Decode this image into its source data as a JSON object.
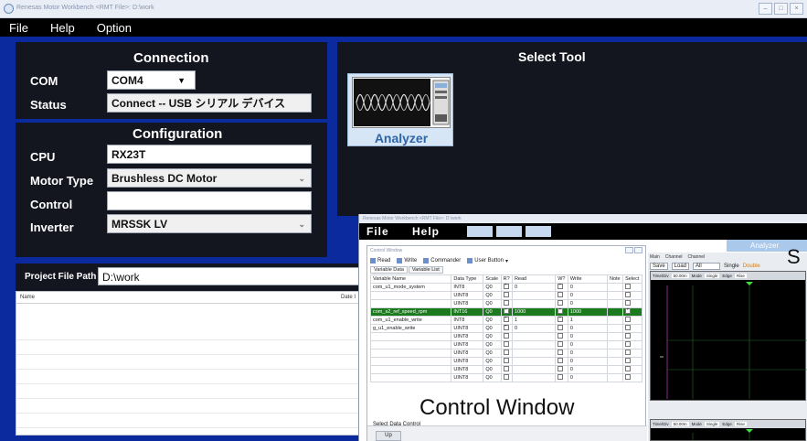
{
  "window": {
    "title": "Renesas Motor Workbench   <RMT File>: D:\\work"
  },
  "menu": {
    "file": "File",
    "help": "Help",
    "option": "Option"
  },
  "connection": {
    "title": "Connection",
    "com_label": "COM",
    "com_value": "COM4",
    "status_label": "Status",
    "status_value": "Connect -- USB シリアル デバイス"
  },
  "configuration": {
    "title": "Configuration",
    "cpu_label": "CPU",
    "cpu_value": "RX23T",
    "motor_label": "Motor Type",
    "motor_value": "Brushless DC Motor",
    "control_label": "Control",
    "control_value": "",
    "inverter_label": "Inverter",
    "inverter_value": "MRSSK LV"
  },
  "select_tool": {
    "title": "Select Tool",
    "analyzer_label": "Analyzer"
  },
  "project": {
    "path_label": "Project File Path",
    "path_value": "D:\\work",
    "col_name": "Name",
    "col_date": "Date I"
  },
  "overlay": {
    "title": "Renesas Motor Workbench   <RMT File>: D:\\work",
    "menu_file": "File",
    "menu_help": "Help",
    "analyzer_button": "Analyzer",
    "big_s": "S",
    "big_label": "Control Window",
    "control_window": {
      "title": "Control Window",
      "toolbar": {
        "read": "Read",
        "write": "Write",
        "commander": "Commander",
        "user_button": "User Button"
      },
      "tabs": [
        "Variable Data",
        "Variable List"
      ],
      "columns": [
        "Variable Name",
        "Data Type",
        "Scale",
        "R?",
        "Read",
        "W?",
        "Write",
        "Note",
        "Select"
      ],
      "rows": [
        {
          "name": "com_u1_mode_system",
          "type": "INT8",
          "scale": "Q0",
          "r": true,
          "read": "0",
          "w": true,
          "write": "0",
          "sel": false
        },
        {
          "name": "",
          "type": "UINT8",
          "scale": "Q0",
          "r": false,
          "read": "",
          "w": false,
          "write": "0",
          "sel": false
        },
        {
          "name": "",
          "type": "UINT8",
          "scale": "Q0",
          "r": false,
          "read": "",
          "w": false,
          "write": "0",
          "sel": false
        },
        {
          "name": "com_s2_ref_speed_rpm",
          "type": "INT16",
          "scale": "Q0",
          "r": true,
          "read": "1000",
          "w": true,
          "write": "1000",
          "sel": true
        },
        {
          "name": "com_u1_enable_write",
          "type": "INT8",
          "scale": "Q0",
          "r": true,
          "read": "1",
          "w": true,
          "write": "1",
          "sel": false
        },
        {
          "name": "g_u1_enable_write",
          "type": "UINT8",
          "scale": "Q0",
          "r": true,
          "read": "0",
          "w": false,
          "write": "0",
          "sel": false
        },
        {
          "name": "",
          "type": "UINT8",
          "scale": "Q0",
          "r": false,
          "read": "",
          "w": false,
          "write": "0",
          "sel": false
        },
        {
          "name": "",
          "type": "UINT8",
          "scale": "Q0",
          "r": false,
          "read": "",
          "w": false,
          "write": "0",
          "sel": false
        },
        {
          "name": "",
          "type": "UINT8",
          "scale": "Q0",
          "r": false,
          "read": "",
          "w": false,
          "write": "0",
          "sel": false
        },
        {
          "name": "",
          "type": "UINT8",
          "scale": "Q0",
          "r": false,
          "read": "",
          "w": false,
          "write": "0",
          "sel": false
        },
        {
          "name": "",
          "type": "UINT8",
          "scale": "Q0",
          "r": false,
          "read": "",
          "w": false,
          "write": "0",
          "sel": false
        },
        {
          "name": "",
          "type": "UINT8",
          "scale": "Q0",
          "r": false,
          "read": "",
          "w": false,
          "write": "0",
          "sel": false
        }
      ],
      "footer_label": "Select Data Control",
      "up_button": "Up"
    },
    "analyzer_pane": {
      "tabs": [
        "Main",
        "Channel",
        "Channel"
      ],
      "save": "Save",
      "load": "Load",
      "all": "All",
      "single": "Single",
      "double": "Double",
      "time_div_label": "Time/Div",
      "time_div_value": "50.00m",
      "mode_label": "Mode",
      "mode_value": "Single",
      "edge_label": "Edge",
      "edge_value": "Rise"
    }
  },
  "colors": {
    "background": "#0a2a9e",
    "panel": "#14161f",
    "selected_row": "#1b7a1e",
    "analyzer_text": "#2e65a6"
  }
}
